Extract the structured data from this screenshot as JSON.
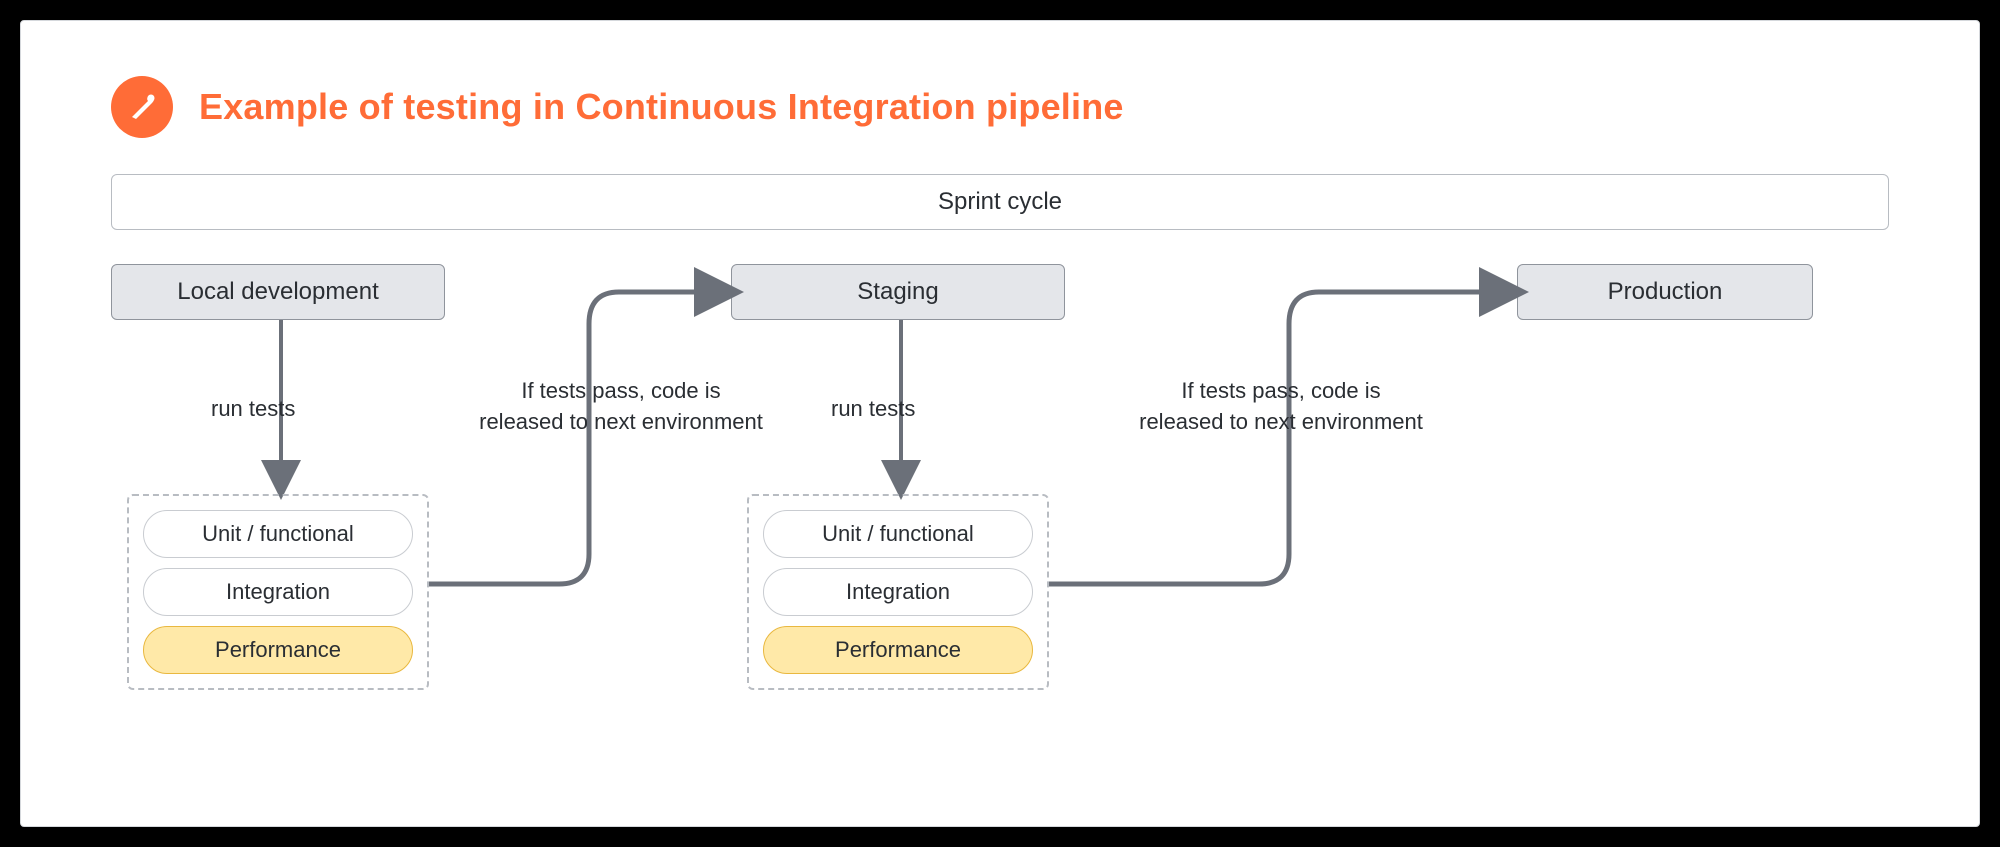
{
  "title": "Example of testing in Continuous Integration pipeline",
  "sprint_label": "Sprint cycle",
  "environments": {
    "local": "Local development",
    "staging": "Staging",
    "production": "Production"
  },
  "arrows": {
    "run_tests": "run tests",
    "pass_text": "If tests pass, code is\nreleased to next environment"
  },
  "tests": {
    "unit": "Unit / functional",
    "integration": "Integration",
    "performance": "Performance"
  },
  "colors": {
    "accent": "#ff6c37",
    "box_fill": "#e4e6ea",
    "box_border": "#8f949c",
    "highlight_fill": "#ffe9a8",
    "highlight_border": "#e9b83f",
    "connector": "#6b7079"
  },
  "icon": "postman-icon"
}
